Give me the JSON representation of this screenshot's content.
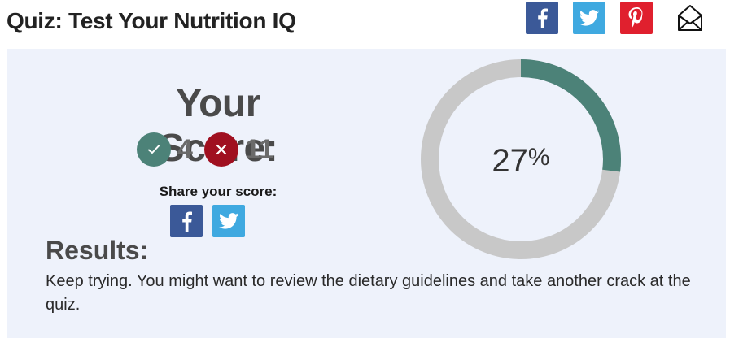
{
  "header": {
    "title": "Quiz: Test Your Nutrition IQ",
    "share_icons": [
      "facebook-icon",
      "twitter-icon",
      "pinterest-icon",
      "email-icon"
    ]
  },
  "score": {
    "heading": "Your Score:",
    "correct_count": "4",
    "incorrect_count": "11",
    "percent_value": "27",
    "percent_sign": "%",
    "percent_fraction": 0.27
  },
  "share_score": {
    "label": "Share your score:",
    "icons": [
      "facebook-icon",
      "twitter-icon"
    ]
  },
  "results": {
    "heading": "Results:",
    "text": "Keep trying. You might want to review the dietary guidelines and take another crack at the quiz."
  },
  "colors": {
    "correct": "#4c8278",
    "incorrect": "#a01020",
    "donut_fill": "#4c8278",
    "donut_track": "#c8c8c8",
    "facebook": "#3b5998",
    "twitter": "#3fa9e0",
    "pinterest": "#e0202e",
    "panel_bg": "#eef2fb"
  }
}
